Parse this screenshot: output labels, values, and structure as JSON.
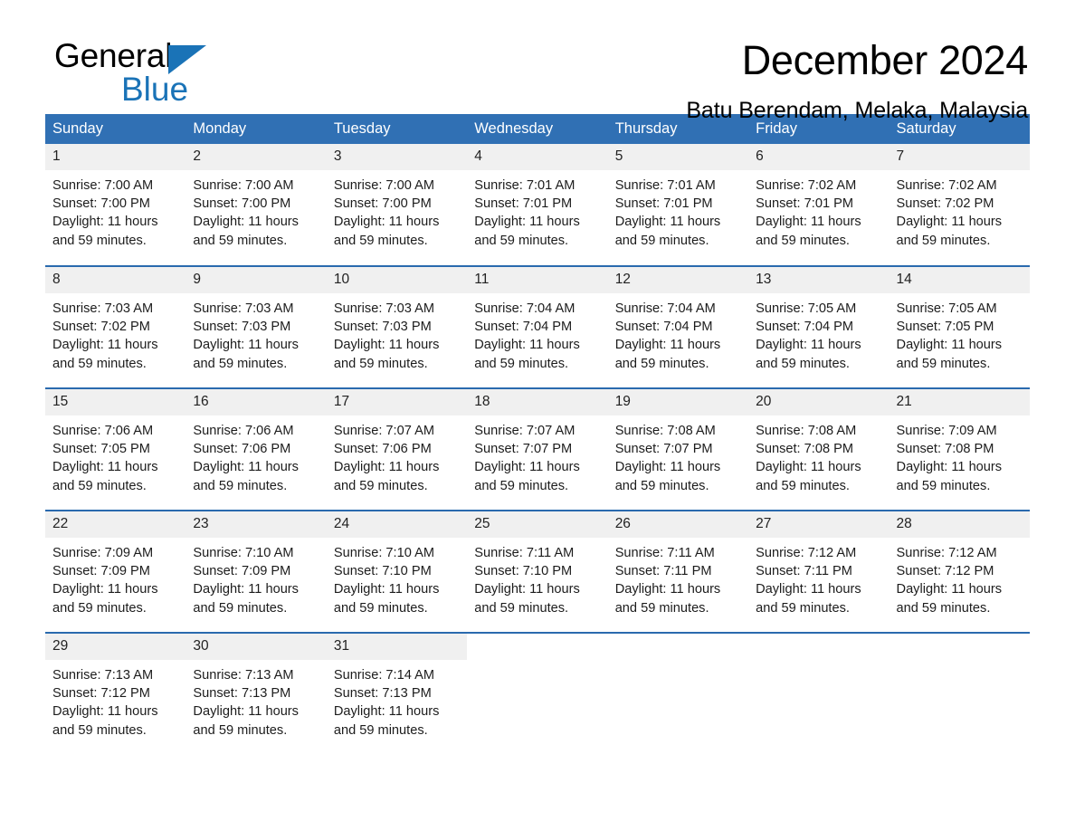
{
  "brand": {
    "name_part1": "General",
    "name_part2": "Blue",
    "accent_color": "#1a73b7"
  },
  "header": {
    "month_title": "December 2024",
    "location": "Batu Berendam, Melaka, Malaysia"
  },
  "calendar": {
    "header_bg": "#3070b4",
    "daynum_bg": "#f0f0f0",
    "row_border_color": "#2a6aae",
    "weekday_headers": [
      "Sunday",
      "Monday",
      "Tuesday",
      "Wednesday",
      "Thursday",
      "Friday",
      "Saturday"
    ],
    "weeks": [
      [
        {
          "day": "1",
          "sunrise": "Sunrise: 7:00 AM",
          "sunset": "Sunset: 7:00 PM",
          "daylight": "Daylight: 11 hours and 59 minutes."
        },
        {
          "day": "2",
          "sunrise": "Sunrise: 7:00 AM",
          "sunset": "Sunset: 7:00 PM",
          "daylight": "Daylight: 11 hours and 59 minutes."
        },
        {
          "day": "3",
          "sunrise": "Sunrise: 7:00 AM",
          "sunset": "Sunset: 7:00 PM",
          "daylight": "Daylight: 11 hours and 59 minutes."
        },
        {
          "day": "4",
          "sunrise": "Sunrise: 7:01 AM",
          "sunset": "Sunset: 7:01 PM",
          "daylight": "Daylight: 11 hours and 59 minutes."
        },
        {
          "day": "5",
          "sunrise": "Sunrise: 7:01 AM",
          "sunset": "Sunset: 7:01 PM",
          "daylight": "Daylight: 11 hours and 59 minutes."
        },
        {
          "day": "6",
          "sunrise": "Sunrise: 7:02 AM",
          "sunset": "Sunset: 7:01 PM",
          "daylight": "Daylight: 11 hours and 59 minutes."
        },
        {
          "day": "7",
          "sunrise": "Sunrise: 7:02 AM",
          "sunset": "Sunset: 7:02 PM",
          "daylight": "Daylight: 11 hours and 59 minutes."
        }
      ],
      [
        {
          "day": "8",
          "sunrise": "Sunrise: 7:03 AM",
          "sunset": "Sunset: 7:02 PM",
          "daylight": "Daylight: 11 hours and 59 minutes."
        },
        {
          "day": "9",
          "sunrise": "Sunrise: 7:03 AM",
          "sunset": "Sunset: 7:03 PM",
          "daylight": "Daylight: 11 hours and 59 minutes."
        },
        {
          "day": "10",
          "sunrise": "Sunrise: 7:03 AM",
          "sunset": "Sunset: 7:03 PM",
          "daylight": "Daylight: 11 hours and 59 minutes."
        },
        {
          "day": "11",
          "sunrise": "Sunrise: 7:04 AM",
          "sunset": "Sunset: 7:04 PM",
          "daylight": "Daylight: 11 hours and 59 minutes."
        },
        {
          "day": "12",
          "sunrise": "Sunrise: 7:04 AM",
          "sunset": "Sunset: 7:04 PM",
          "daylight": "Daylight: 11 hours and 59 minutes."
        },
        {
          "day": "13",
          "sunrise": "Sunrise: 7:05 AM",
          "sunset": "Sunset: 7:04 PM",
          "daylight": "Daylight: 11 hours and 59 minutes."
        },
        {
          "day": "14",
          "sunrise": "Sunrise: 7:05 AM",
          "sunset": "Sunset: 7:05 PM",
          "daylight": "Daylight: 11 hours and 59 minutes."
        }
      ],
      [
        {
          "day": "15",
          "sunrise": "Sunrise: 7:06 AM",
          "sunset": "Sunset: 7:05 PM",
          "daylight": "Daylight: 11 hours and 59 minutes."
        },
        {
          "day": "16",
          "sunrise": "Sunrise: 7:06 AM",
          "sunset": "Sunset: 7:06 PM",
          "daylight": "Daylight: 11 hours and 59 minutes."
        },
        {
          "day": "17",
          "sunrise": "Sunrise: 7:07 AM",
          "sunset": "Sunset: 7:06 PM",
          "daylight": "Daylight: 11 hours and 59 minutes."
        },
        {
          "day": "18",
          "sunrise": "Sunrise: 7:07 AM",
          "sunset": "Sunset: 7:07 PM",
          "daylight": "Daylight: 11 hours and 59 minutes."
        },
        {
          "day": "19",
          "sunrise": "Sunrise: 7:08 AM",
          "sunset": "Sunset: 7:07 PM",
          "daylight": "Daylight: 11 hours and 59 minutes."
        },
        {
          "day": "20",
          "sunrise": "Sunrise: 7:08 AM",
          "sunset": "Sunset: 7:08 PM",
          "daylight": "Daylight: 11 hours and 59 minutes."
        },
        {
          "day": "21",
          "sunrise": "Sunrise: 7:09 AM",
          "sunset": "Sunset: 7:08 PM",
          "daylight": "Daylight: 11 hours and 59 minutes."
        }
      ],
      [
        {
          "day": "22",
          "sunrise": "Sunrise: 7:09 AM",
          "sunset": "Sunset: 7:09 PM",
          "daylight": "Daylight: 11 hours and 59 minutes."
        },
        {
          "day": "23",
          "sunrise": "Sunrise: 7:10 AM",
          "sunset": "Sunset: 7:09 PM",
          "daylight": "Daylight: 11 hours and 59 minutes."
        },
        {
          "day": "24",
          "sunrise": "Sunrise: 7:10 AM",
          "sunset": "Sunset: 7:10 PM",
          "daylight": "Daylight: 11 hours and 59 minutes."
        },
        {
          "day": "25",
          "sunrise": "Sunrise: 7:11 AM",
          "sunset": "Sunset: 7:10 PM",
          "daylight": "Daylight: 11 hours and 59 minutes."
        },
        {
          "day": "26",
          "sunrise": "Sunrise: 7:11 AM",
          "sunset": "Sunset: 7:11 PM",
          "daylight": "Daylight: 11 hours and 59 minutes."
        },
        {
          "day": "27",
          "sunrise": "Sunrise: 7:12 AM",
          "sunset": "Sunset: 7:11 PM",
          "daylight": "Daylight: 11 hours and 59 minutes."
        },
        {
          "day": "28",
          "sunrise": "Sunrise: 7:12 AM",
          "sunset": "Sunset: 7:12 PM",
          "daylight": "Daylight: 11 hours and 59 minutes."
        }
      ],
      [
        {
          "day": "29",
          "sunrise": "Sunrise: 7:13 AM",
          "sunset": "Sunset: 7:12 PM",
          "daylight": "Daylight: 11 hours and 59 minutes."
        },
        {
          "day": "30",
          "sunrise": "Sunrise: 7:13 AM",
          "sunset": "Sunset: 7:13 PM",
          "daylight": "Daylight: 11 hours and 59 minutes."
        },
        {
          "day": "31",
          "sunrise": "Sunrise: 7:14 AM",
          "sunset": "Sunset: 7:13 PM",
          "daylight": "Daylight: 11 hours and 59 minutes."
        },
        {
          "day": "",
          "sunrise": "",
          "sunset": "",
          "daylight": ""
        },
        {
          "day": "",
          "sunrise": "",
          "sunset": "",
          "daylight": ""
        },
        {
          "day": "",
          "sunrise": "",
          "sunset": "",
          "daylight": ""
        },
        {
          "day": "",
          "sunrise": "",
          "sunset": "",
          "daylight": ""
        }
      ]
    ]
  }
}
